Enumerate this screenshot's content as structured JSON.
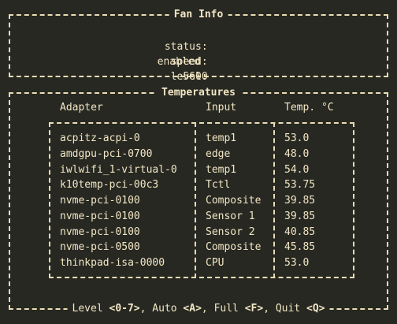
{
  "fan_info": {
    "title": "Fan Info",
    "status_label": "status:",
    "status_value": "enabled",
    "speed_label": "speed:",
    "speed_value": "5600",
    "level_label": "level:",
    "level_value": "disengaged"
  },
  "temperatures": {
    "title": "Temperatures",
    "columns": [
      "Adapter",
      "Input",
      "Temp. °C"
    ],
    "rows": [
      {
        "adapter": "acpitz-acpi-0",
        "input": "temp1",
        "temp": "53.0"
      },
      {
        "adapter": "amdgpu-pci-0700",
        "input": "edge",
        "temp": "48.0"
      },
      {
        "adapter": "iwlwifi_1-virtual-0",
        "input": "temp1",
        "temp": "54.0"
      },
      {
        "adapter": "k10temp-pci-00c3",
        "input": "Tctl",
        "temp": "53.75"
      },
      {
        "adapter": "nvme-pci-0100",
        "input": "Composite",
        "temp": "39.85"
      },
      {
        "adapter": "nvme-pci-0100",
        "input": "Sensor 1",
        "temp": "39.85"
      },
      {
        "adapter": "nvme-pci-0100",
        "input": "Sensor 2",
        "temp": "40.85"
      },
      {
        "adapter": "nvme-pci-0500",
        "input": "Composite",
        "temp": "45.85"
      },
      {
        "adapter": "thinkpad-isa-0000",
        "input": "CPU",
        "temp": "53.0"
      }
    ]
  },
  "footer": {
    "level_text": "Level ",
    "level_key": "<0-7>",
    "auto_text": ", Auto ",
    "auto_key": "<A>",
    "full_text": ", Full ",
    "full_key": "<F>",
    "quit_text": ", Quit ",
    "quit_key": "<Q>"
  }
}
